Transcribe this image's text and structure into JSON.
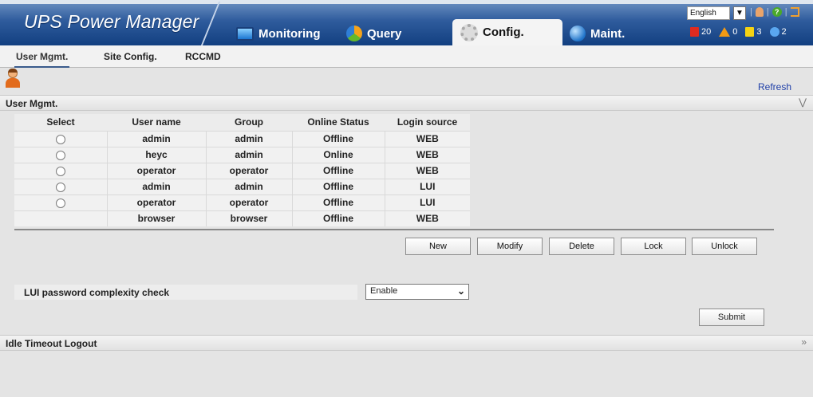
{
  "header": {
    "brand": "UPS Power Manager",
    "tabs": [
      {
        "label": "Monitoring",
        "icon": "monitor-icon"
      },
      {
        "label": "Query",
        "icon": "pie-chart-icon"
      },
      {
        "label": "Config.",
        "icon": "gear-icon",
        "active": true
      },
      {
        "label": "Maint.",
        "icon": "globe-icon"
      }
    ],
    "language": "English",
    "alarms": {
      "critical": "20",
      "major": "0",
      "minor": "3",
      "warning": "2"
    }
  },
  "subnav": {
    "items": [
      "User Mgmt.",
      "Site Config.",
      "RCCMD"
    ],
    "active": "User Mgmt."
  },
  "toolbar": {
    "refresh": "Refresh"
  },
  "user_section": {
    "title": "User Mgmt.",
    "columns": [
      "Select",
      "User name",
      "Group",
      "Online Status",
      "Login source"
    ],
    "rows": [
      {
        "select": true,
        "user": "admin",
        "group": "admin",
        "status": "Offline",
        "source": "WEB"
      },
      {
        "select": true,
        "user": "heyc",
        "group": "admin",
        "status": "Online",
        "source": "WEB"
      },
      {
        "select": true,
        "user": "operator",
        "group": "operator",
        "status": "Offline",
        "source": "WEB"
      },
      {
        "select": true,
        "user": "admin",
        "group": "admin",
        "status": "Offline",
        "source": "LUI"
      },
      {
        "select": true,
        "user": "operator",
        "group": "operator",
        "status": "Offline",
        "source": "LUI"
      },
      {
        "select": false,
        "user": "browser",
        "group": "browser",
        "status": "Offline",
        "source": "WEB"
      }
    ],
    "buttons": {
      "new": "New",
      "modify": "Modify",
      "delete": "Delete",
      "lock": "Lock",
      "unlock": "Unlock"
    },
    "lui_label": "LUI password complexity check",
    "lui_value": "Enable",
    "submit": "Submit"
  },
  "idle_section": {
    "title": "Idle Timeout Logout"
  },
  "colors": {
    "header": "#2f5c9d",
    "link": "#1f3fa8",
    "critical": "#e02b20",
    "major": "#f29a14",
    "minor": "#f5d312",
    "warning": "#5aa7f0"
  }
}
